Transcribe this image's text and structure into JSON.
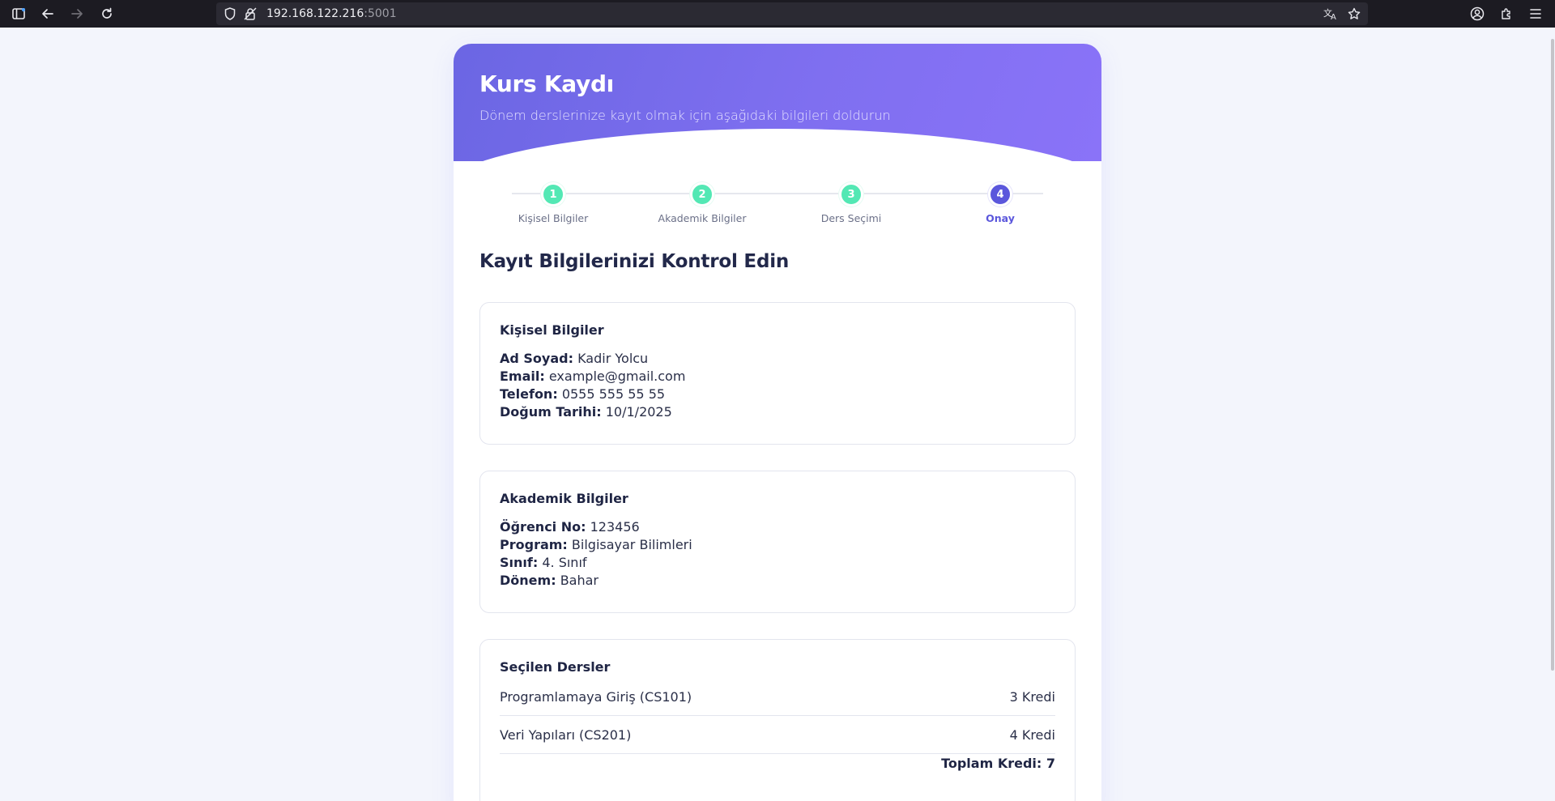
{
  "browser": {
    "url_host": "192.168.122.216",
    "url_port": ":5001"
  },
  "header": {
    "title": "Kurs Kaydı",
    "subtitle": "Dönem derslerinize kayıt olmak için aşağıdaki bilgileri doldurun"
  },
  "steps": [
    {
      "number": "1",
      "label": "Kişisel Bilgiler",
      "state": "completed"
    },
    {
      "number": "2",
      "label": "Akademik Bilgiler",
      "state": "completed"
    },
    {
      "number": "3",
      "label": "Ders Seçimi",
      "state": "completed"
    },
    {
      "number": "4",
      "label": "Onay",
      "state": "active"
    }
  ],
  "review": {
    "title": "Kayıt Bilgilerinizi Kontrol Edin",
    "personal": {
      "heading": "Kişisel Bilgiler",
      "fields": [
        {
          "label": "Ad Soyad:",
          "value": "Kadir Yolcu"
        },
        {
          "label": "Email:",
          "value": "example@gmail.com"
        },
        {
          "label": "Telefon:",
          "value": "0555 555 55 55"
        },
        {
          "label": "Doğum Tarihi:",
          "value": "10/1/2025"
        }
      ]
    },
    "academic": {
      "heading": "Akademik Bilgiler",
      "fields": [
        {
          "label": "Öğrenci No:",
          "value": "123456"
        },
        {
          "label": "Program:",
          "value": "Bilgisayar Bilimleri"
        },
        {
          "label": "Sınıf:",
          "value": "4. Sınıf"
        },
        {
          "label": "Dönem:",
          "value": "Bahar"
        }
      ]
    },
    "courses": {
      "heading": "Seçilen Dersler",
      "items": [
        {
          "name": "Programlamaya Giriş (CS101)",
          "credits": "3 Kredi"
        },
        {
          "name": "Veri Yapıları (CS201)",
          "credits": "4 Kredi"
        }
      ],
      "total": "Toplam Kredi: 7"
    }
  },
  "colors": {
    "accent": "#5b57dc",
    "completed_step": "#53e8b4",
    "header_gradient_start": "#6b66e3",
    "header_gradient_end": "#8a73f8"
  }
}
